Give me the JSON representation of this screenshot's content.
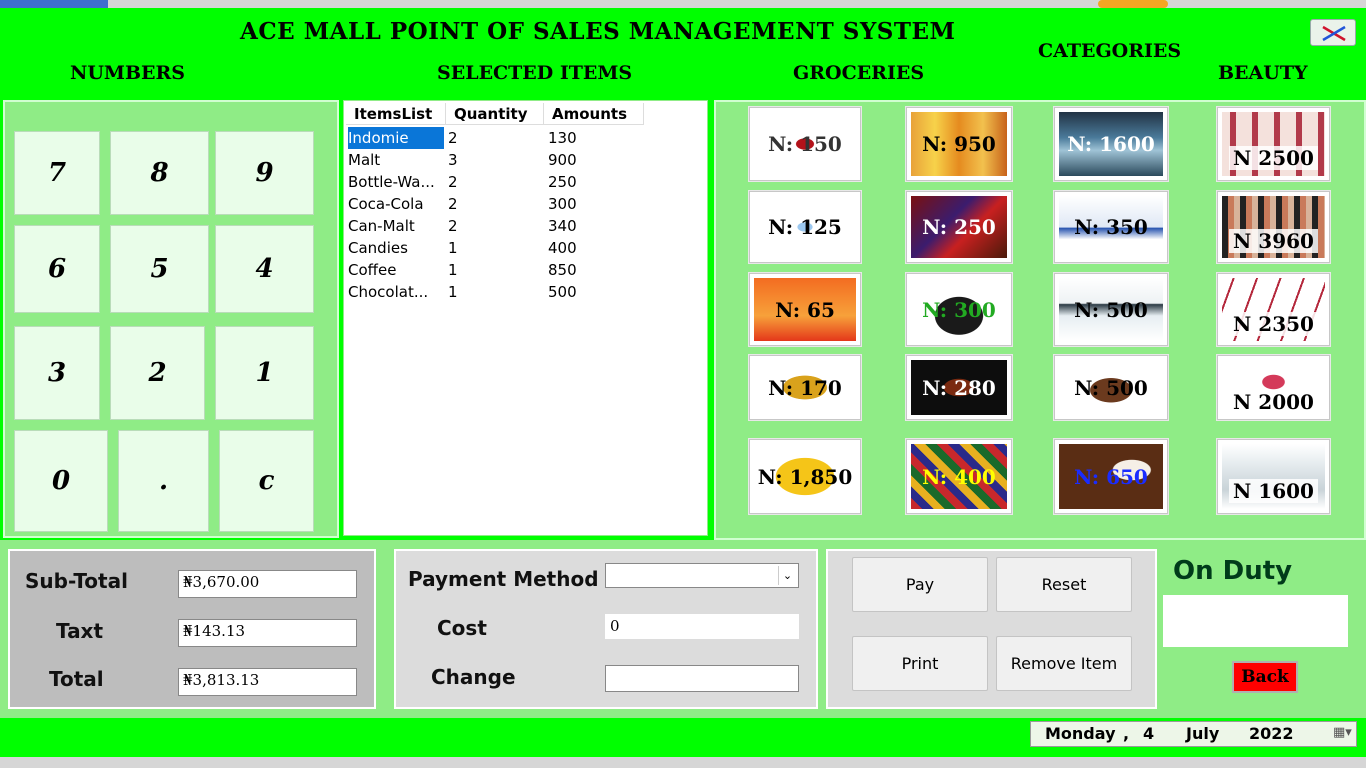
{
  "window": {
    "title": "ACE MALL POINT OF SALES MANAGEMENT SYSTEM"
  },
  "headers": {
    "numbers": "NUMBERS",
    "selected_items": "SELECTED ITEMS",
    "groceries": "GROCERIES",
    "categories": "CATEGORIES",
    "beauty": "BEAUTY"
  },
  "numpad": {
    "keys": [
      "7",
      "8",
      "9",
      "6",
      "5",
      "4",
      "3",
      "2",
      "1",
      "0",
      ".",
      "c"
    ]
  },
  "items_list": {
    "columns": [
      "ItemsList",
      "Quantity",
      "Amounts"
    ],
    "rows": [
      {
        "item": "Indomie",
        "qty": "2",
        "amount": "130"
      },
      {
        "item": "Malt",
        "qty": "3",
        "amount": "900"
      },
      {
        "item": "Bottle-Wa...",
        "qty": "2",
        "amount": "250"
      },
      {
        "item": "Coca-Cola",
        "qty": "2",
        "amount": "300"
      },
      {
        "item": "Can-Malt",
        "qty": "2",
        "amount": "340"
      },
      {
        "item": "Candies",
        "qty": "1",
        "amount": "400"
      },
      {
        "item": "Coffee",
        "qty": "1",
        "amount": "850"
      },
      {
        "item": "Chocolat...",
        "qty": "1",
        "amount": "500"
      }
    ]
  },
  "products": [
    {
      "price": "N: 150",
      "price_color": "#333333",
      "icon": "coca-cola-bottle"
    },
    {
      "price": "N: 950",
      "price_color": "#000000",
      "icon": "juice-bottles"
    },
    {
      "price": "N: 1600",
      "price_color": "#ffffff",
      "icon": "water-splash"
    },
    {
      "price": "N 2500",
      "price_color": "#000000",
      "icon": "lipsticks"
    },
    {
      "price": "N: 125",
      "price_color": "#000000",
      "icon": "water-bottle"
    },
    {
      "price": "N: 250",
      "price_color": "#ffffff",
      "icon": "chocolate-bars"
    },
    {
      "price": "N: 350",
      "price_color": "#000000",
      "icon": "milk-box"
    },
    {
      "price": "N 3960",
      "price_color": "#000000",
      "icon": "makeup-palette"
    },
    {
      "price": "N: 65",
      "price_color": "#000000",
      "icon": "noodles-pack"
    },
    {
      "price": "N: 300",
      "price_color": "#22aa22",
      "icon": "malt-bottle"
    },
    {
      "price": "N: 500",
      "price_color": "#000000",
      "icon": "toothpaste"
    },
    {
      "price": "N 2350",
      "price_color": "#000000",
      "icon": "eyeliners"
    },
    {
      "price": "N: 170",
      "price_color": "#000000",
      "icon": "malt-can"
    },
    {
      "price": "N: 280",
      "price_color": "#ffffff",
      "icon": "coffee-cup"
    },
    {
      "price": "N: 500",
      "price_color": "#000000",
      "icon": "chocolate-cake"
    },
    {
      "price": "N 2000",
      "price_color": "#000000",
      "icon": "lip-gloss"
    },
    {
      "price": "N: 1,850",
      "price_color": "#000000",
      "icon": "oil-bottle"
    },
    {
      "price": "N: 400",
      "price_color": "#ffff00",
      "icon": "candies"
    },
    {
      "price": "N: 650",
      "price_color": "#1a2cff",
      "icon": "coffee-beans"
    },
    {
      "price": "N 1600",
      "price_color": "#000000",
      "icon": "soap-bar"
    }
  ],
  "totals": {
    "subtotal_label": "Sub-Total",
    "subtotal_value": "₦3,670.00",
    "tax_label": "Taxt",
    "tax_value": "₦143.13",
    "total_label": "Total",
    "total_value": "₦3,813.13"
  },
  "payment": {
    "method_label": "Payment Method",
    "method_value": "",
    "cost_label": "Cost",
    "cost_value": "0",
    "change_label": "Change",
    "change_value": ""
  },
  "actions": {
    "pay": "Pay",
    "reset": "Reset",
    "print": "Print",
    "remove": "Remove Item"
  },
  "duty": {
    "label": "On Duty",
    "value": "",
    "back": "Back"
  },
  "date": {
    "weekday": "Monday",
    "sep": ",",
    "day": "4",
    "month": "July",
    "year": "2022"
  },
  "colors": {
    "window_bg": "#00ff00",
    "panel_bg": "#8fec86",
    "back_button": "#ff0000",
    "selection": "#0a76d8"
  }
}
